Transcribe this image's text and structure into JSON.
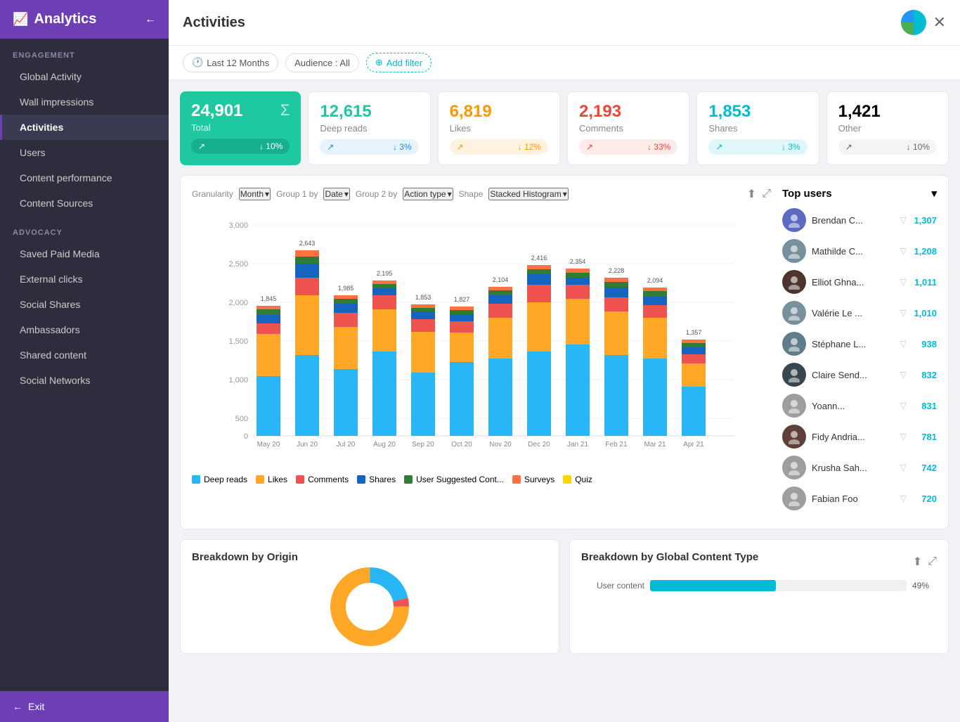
{
  "sidebar": {
    "title": "Analytics",
    "back_icon": "←",
    "sections": [
      {
        "label": "ENGAGEMENT",
        "items": [
          {
            "id": "global-activity",
            "label": "Global Activity",
            "active": false
          },
          {
            "id": "wall-impressions",
            "label": "Wall impressions",
            "active": false
          },
          {
            "id": "activities",
            "label": "Activities",
            "active": true
          },
          {
            "id": "users",
            "label": "Users",
            "active": false
          },
          {
            "id": "content-performance",
            "label": "Content performance",
            "active": false
          },
          {
            "id": "content-sources",
            "label": "Content Sources",
            "active": false
          }
        ]
      },
      {
        "label": "ADVOCACY",
        "items": [
          {
            "id": "saved-paid-media",
            "label": "Saved Paid Media",
            "active": false
          },
          {
            "id": "external-clicks",
            "label": "External clicks",
            "active": false
          },
          {
            "id": "social-shares",
            "label": "Social Shares",
            "active": false
          },
          {
            "id": "ambassadors",
            "label": "Ambassadors",
            "active": false
          },
          {
            "id": "shared-content",
            "label": "Shared content",
            "active": false
          },
          {
            "id": "social-networks",
            "label": "Social Networks",
            "active": false
          }
        ]
      }
    ],
    "footer_label": "Exit"
  },
  "topbar": {
    "title": "Activities",
    "close_label": "✕"
  },
  "filters": {
    "time_label": "Last 12 Months",
    "audience_label": "Audience : All",
    "add_filter_label": "Add filter"
  },
  "stats": [
    {
      "id": "total",
      "value": "24,901",
      "label": "Total",
      "variant": "green",
      "footer_trend": "↗",
      "footer_change": "↓ 10%"
    },
    {
      "id": "deep-reads",
      "value": "12,615",
      "label": "Deep reads",
      "variant": "blue",
      "footer_trend": "↗",
      "footer_change": "↓ 3%"
    },
    {
      "id": "likes",
      "value": "6,819",
      "label": "Likes",
      "variant": "orange",
      "footer_trend": "↗",
      "footer_change": "↓ 12%"
    },
    {
      "id": "comments",
      "value": "2,193",
      "label": "Comments",
      "variant": "red",
      "footer_trend": "↗",
      "footer_change": "↓ 33%"
    },
    {
      "id": "shares",
      "value": "1,853",
      "label": "Shares",
      "variant": "teal",
      "footer_trend": "↗",
      "footer_change": "↓ 3%"
    },
    {
      "id": "other",
      "value": "1,421",
      "label": "Other",
      "variant": "gray",
      "footer_trend": "↗",
      "footer_change": "↓ 10%"
    }
  ],
  "chart": {
    "granularity_label": "Granularity",
    "granularity_value": "Month",
    "group1_label": "Group 1 by",
    "group1_value": "Date",
    "group2_label": "Group 2 by",
    "group2_value": "Action type",
    "shape_label": "Shape",
    "shape_value": "Stacked Histogram",
    "bars": [
      {
        "month": "May 20",
        "total": 1845,
        "deep_reads": 850,
        "likes": 600,
        "comments": 150,
        "shares": 120,
        "user_content": 80,
        "surveys": 45
      },
      {
        "month": "Jun 20",
        "total": 2643,
        "deep_reads": 1150,
        "likes": 850,
        "comments": 250,
        "shares": 200,
        "user_content": 100,
        "surveys": 93
      },
      {
        "month": "Jul 20",
        "total": 1985,
        "deep_reads": 950,
        "likes": 600,
        "comments": 200,
        "shares": 130,
        "user_content": 70,
        "surveys": 35
      },
      {
        "month": "Aug 20",
        "total": 2195,
        "deep_reads": 1200,
        "likes": 600,
        "comments": 200,
        "shares": 100,
        "user_content": 60,
        "surveys": 35
      },
      {
        "month": "Sep 20",
        "total": 1853,
        "deep_reads": 900,
        "likes": 580,
        "comments": 180,
        "shares": 110,
        "user_content": 50,
        "surveys": 33
      },
      {
        "month": "Oct 20",
        "total": 1827,
        "deep_reads": 1050,
        "likes": 420,
        "comments": 160,
        "shares": 100,
        "user_content": 60,
        "surveys": 37
      },
      {
        "month": "Nov 20",
        "total": 2104,
        "deep_reads": 1100,
        "likes": 580,
        "comments": 200,
        "shares": 120,
        "user_content": 70,
        "surveys": 34
      },
      {
        "month": "Dec 20",
        "total": 2416,
        "deep_reads": 1200,
        "likes": 700,
        "comments": 250,
        "shares": 150,
        "user_content": 70,
        "surveys": 46
      },
      {
        "month": "Jan 21",
        "total": 2354,
        "deep_reads": 1300,
        "likes": 650,
        "comments": 200,
        "shares": 100,
        "user_content": 70,
        "surveys": 34
      },
      {
        "month": "Feb 21",
        "total": 2228,
        "deep_reads": 1150,
        "likes": 620,
        "comments": 200,
        "shares": 140,
        "user_content": 80,
        "surveys": 38
      },
      {
        "month": "Mar 21",
        "total": 2094,
        "deep_reads": 1100,
        "likes": 580,
        "comments": 180,
        "shares": 120,
        "user_content": 80,
        "surveys": 34
      },
      {
        "month": "Apr 21",
        "total": 1357,
        "deep_reads": 700,
        "likes": 330,
        "comments": 130,
        "shares": 100,
        "user_content": 60,
        "surveys": 37
      }
    ],
    "legend": [
      {
        "label": "Deep reads",
        "color": "#29b6f6"
      },
      {
        "label": "Likes",
        "color": "#ffa726"
      },
      {
        "label": "Comments",
        "color": "#ef5350"
      },
      {
        "label": "Shares",
        "color": "#1565c0"
      },
      {
        "label": "User Suggested Cont...",
        "color": "#2e7d32"
      },
      {
        "label": "Surveys",
        "color": "#ff7043"
      },
      {
        "label": "Quiz",
        "color": "#ffd600"
      }
    ]
  },
  "top_users": {
    "title": "Top users",
    "users": [
      {
        "name": "Brendan C...",
        "score": "1,307",
        "avatar_color": "#5c6bc0"
      },
      {
        "name": "Mathilde C...",
        "score": "1,208",
        "avatar_color": "#78909c"
      },
      {
        "name": "Elliot Ghna...",
        "score": "1,011",
        "avatar_color": "#4e342e"
      },
      {
        "name": "Valérie Le ...",
        "score": "1,010",
        "avatar_color": "#78909c"
      },
      {
        "name": "Stéphane L...",
        "score": "938",
        "avatar_color": "#607d8b"
      },
      {
        "name": "Claire Send...",
        "score": "832",
        "avatar_color": "#37474f"
      },
      {
        "name": "Yoann...",
        "score": "831",
        "avatar_color": "#9e9e9e"
      },
      {
        "name": "Fidy Andria...",
        "score": "781",
        "avatar_color": "#5d4037"
      },
      {
        "name": "Krusha Sah...",
        "score": "742",
        "avatar_color": "#9e9e9e"
      },
      {
        "name": "Fabian Foo",
        "score": "720",
        "avatar_color": "#9e9e9e"
      }
    ]
  },
  "bottom_charts": {
    "origin": {
      "title": "Breakdown by Origin"
    },
    "content_type": {
      "title": "Breakdown by Global Content Type",
      "bars": [
        {
          "label": "User content",
          "pct": 49,
          "display": "49%"
        }
      ]
    }
  },
  "colors": {
    "sidebar_bg": "#2d2d3e",
    "sidebar_accent": "#6c3fb5",
    "accent": "#00bcd4",
    "green": "#1ec8a0"
  }
}
